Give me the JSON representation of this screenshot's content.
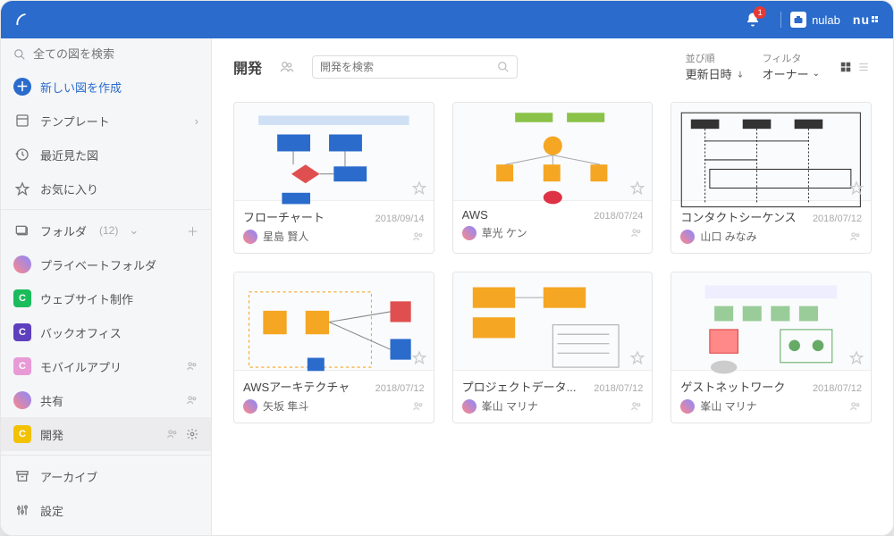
{
  "topbar": {
    "notification_count": "1",
    "nulab_label": "nulab",
    "nu_logo": "nu"
  },
  "sidebar": {
    "search_placeholder": "全ての図を検索",
    "create_label": "新しい図を作成",
    "templates_label": "テンプレート",
    "recent_label": "最近見た図",
    "favorites_label": "お気に入り",
    "folders_label": "フォルダ",
    "folders_count": "(12)",
    "folders": [
      {
        "label": "プライベートフォルダ",
        "color": "avatar"
      },
      {
        "label": "ウェブサイト制作",
        "color": "#1abc5b"
      },
      {
        "label": "バックオフィス",
        "color": "#5e3fbe"
      },
      {
        "label": "モバイルアプリ",
        "color": "#e89ad6",
        "shared": true
      },
      {
        "label": "共有",
        "color": "avatar",
        "shared": true
      },
      {
        "label": "開発",
        "color": "#f2c200",
        "shared": true,
        "active": true,
        "gear": true
      }
    ],
    "archive_label": "アーカイブ",
    "settings_label": "設定"
  },
  "toolbar": {
    "title": "開発",
    "search_placeholder": "開発を検索",
    "sort_label": "並び順",
    "sort_value": "更新日時",
    "filter_label": "フィルタ",
    "filter_value": "オーナー"
  },
  "cards": [
    {
      "title": "フローチャート",
      "date": "2018/09/14",
      "owner": "星島 賢人",
      "thumb": "flowchart"
    },
    {
      "title": "AWS",
      "date": "2018/07/24",
      "owner": "草光 ケン",
      "thumb": "aws"
    },
    {
      "title": "コンタクトシーケンス",
      "date": "2018/07/12",
      "owner": "山口 みなみ",
      "thumb": "sequence"
    },
    {
      "title": "AWSアーキテクチャ",
      "date": "2018/07/12",
      "owner": "矢坂 隼斗",
      "thumb": "awsarch"
    },
    {
      "title": "プロジェクトデータ...",
      "date": "2018/07/12",
      "owner": "峯山 マリナ",
      "thumb": "project"
    },
    {
      "title": "ゲストネットワーク",
      "date": "2018/07/12",
      "owner": "峯山 マリナ",
      "thumb": "network"
    }
  ]
}
